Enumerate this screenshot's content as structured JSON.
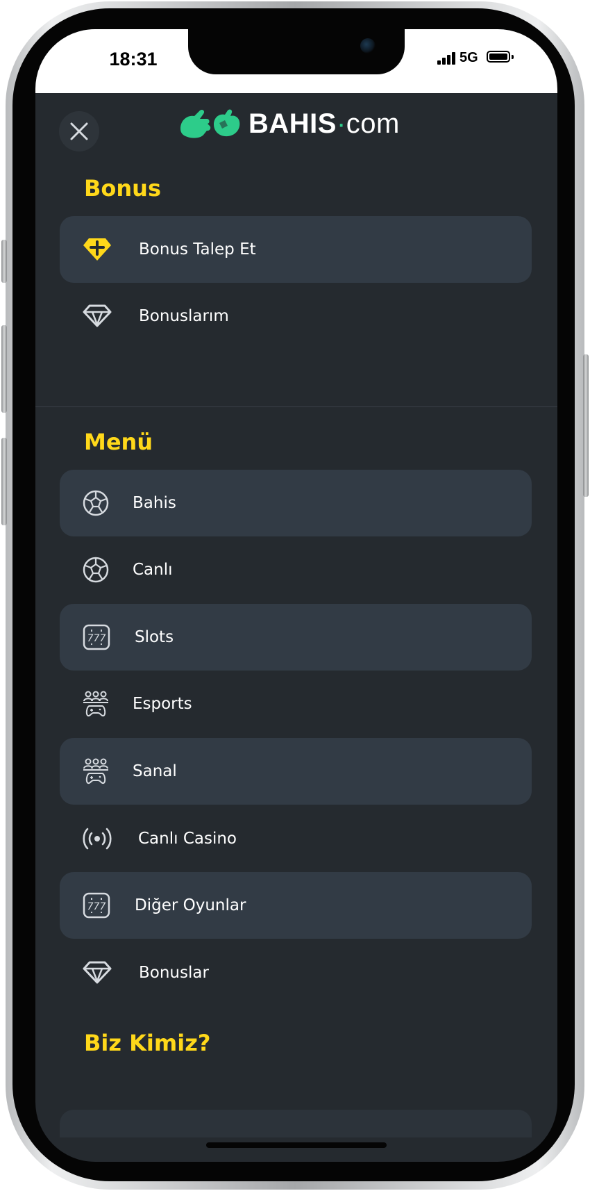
{
  "status_bar": {
    "time": "18:31",
    "network": "5G"
  },
  "header": {
    "close_icon": "close-icon",
    "logo_text_bold": "BAHIS",
    "logo_text_light": "com"
  },
  "bonus_section": {
    "title": "Bonus",
    "items": [
      {
        "label": "Bonus Talep Et",
        "icon": "diamond-plus-icon",
        "highlighted": true
      },
      {
        "label": "Bonuslarım",
        "icon": "diamond-icon",
        "highlighted": false
      }
    ]
  },
  "menu_section": {
    "title": "Menü",
    "items": [
      {
        "label": "Bahis",
        "icon": "soccer-ball-icon",
        "highlighted": true
      },
      {
        "label": "Canlı",
        "icon": "soccer-ball-icon",
        "highlighted": false
      },
      {
        "label": "Slots",
        "icon": "slot-machine-icon",
        "highlighted": true
      },
      {
        "label": "Esports",
        "icon": "gamepad-users-icon",
        "highlighted": false
      },
      {
        "label": "Sanal",
        "icon": "gamepad-users-icon",
        "highlighted": true
      },
      {
        "label": "Canlı Casino",
        "icon": "broadcast-icon",
        "highlighted": false
      },
      {
        "label": "Diğer Oyunlar",
        "icon": "slot-machine-icon",
        "highlighted": true
      },
      {
        "label": "Bonuslar",
        "icon": "diamond-icon",
        "highlighted": false
      }
    ]
  },
  "about_section": {
    "title": "Biz Kimiz?"
  },
  "colors": {
    "background": "#252a2f",
    "highlight_row": "#323b45",
    "section_title": "#ffd81a",
    "brand_green": "#2dcc8a",
    "text": "#ffffff"
  }
}
